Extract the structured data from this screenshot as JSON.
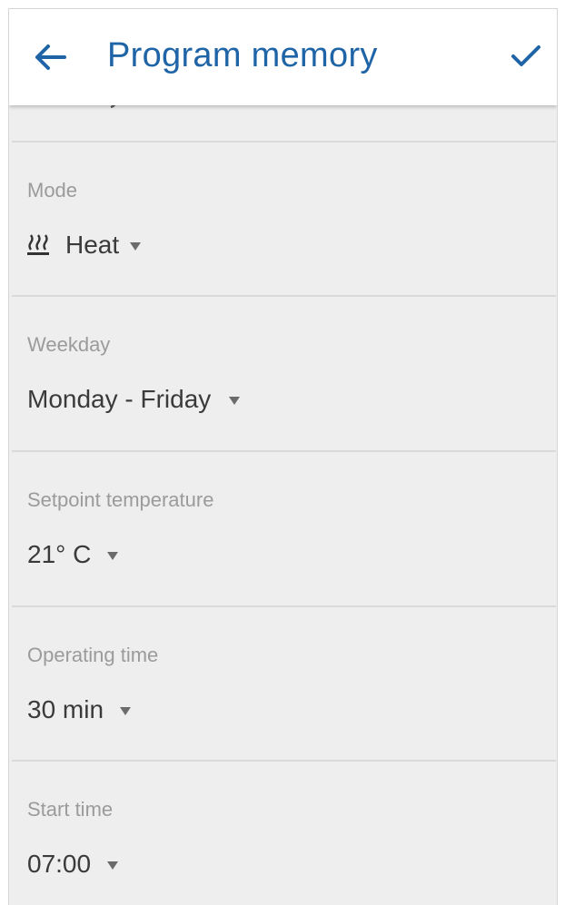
{
  "appbar": {
    "title": "Program memory",
    "back_icon": "arrow-left-icon",
    "confirm_icon": "check-icon",
    "accent_color": "#1f64a6"
  },
  "fields": {
    "mode": {
      "label": "Mode",
      "value": "Heat",
      "icon": "heat-icon"
    },
    "weekday": {
      "label": "Weekday",
      "value": "Monday - Friday"
    },
    "setpoint": {
      "label": "Setpoint temperature",
      "value": "21° C"
    },
    "operating_time": {
      "label": "Operating time",
      "value": "30 min"
    },
    "start_time": {
      "label": "Start time",
      "value": "07:00"
    }
  }
}
